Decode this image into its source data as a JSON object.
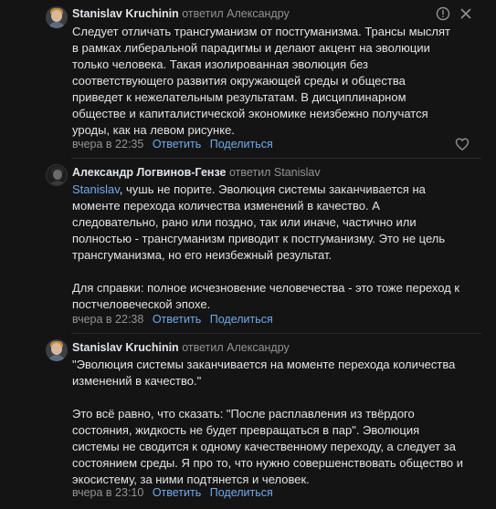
{
  "comments": [
    {
      "author": "Stanislav Kruchinin",
      "replied_label": "ответил",
      "replied_to": "Александру",
      "text": "Следует отличать трансгуманизм от постгуманизма. Трансы мыслят\nв рамках либеральной парадигмы и делают акцент на эволюции\nтолько человека. Такая изолированная эволюция без\nсоответствующего развития окружающей среды и общества\nприведет к нежелательным результатам. В дисциплинарном\nобществе и капиталистической экономике неизбежно получатся\nуроды, как на левом рисунке.",
      "date": "вчера в 22:35",
      "reply_label": "Ответить",
      "share_label": "Поделиться",
      "icons": [
        "report-icon",
        "close-icon",
        "like-heart-icon"
      ]
    },
    {
      "author": "Александр Логвинов-Гензе",
      "replied_label": "ответил",
      "replied_to": "Stanislav",
      "mention": "Stanislav",
      "text": ", чушь не порите. Эволюция системы заканчивается на\nмоменте перехода количества изменений в качество. А\nследовательно, рано или поздно, так или иначе, частично или\nполностью - трансгуманизм приводит к постгуманизму. Это не цель\nтрансгуманизма, но его неизбежный результат.\n\nДля справки: полное исчезновение человечества - это тоже переход к\nпостчеловеческой эпохе.",
      "date": "вчера в 22:38",
      "reply_label": "Ответить",
      "share_label": "Поделиться"
    },
    {
      "author": "Stanislav Kruchinin",
      "replied_label": "ответил",
      "replied_to": "Александру",
      "text": "\"Эволюция системы заканчивается на моменте перехода количества\nизменений в качество.\"\n\nЭто всё равно, что сказать: \"После расплавления из твёрдого\nсостояния, жидкость не будет превращаться в пар\". Эволюция\nсистемы не сводится к одному качественному переходу, а следует за\nсостоянием среды. Я про то, что нужно совершенствовать общество и\nэкосистему, за ними подтянется и человек.",
      "date": "вчера в 23:10",
      "reply_label": "Ответить",
      "share_label": "Поделиться"
    }
  ]
}
